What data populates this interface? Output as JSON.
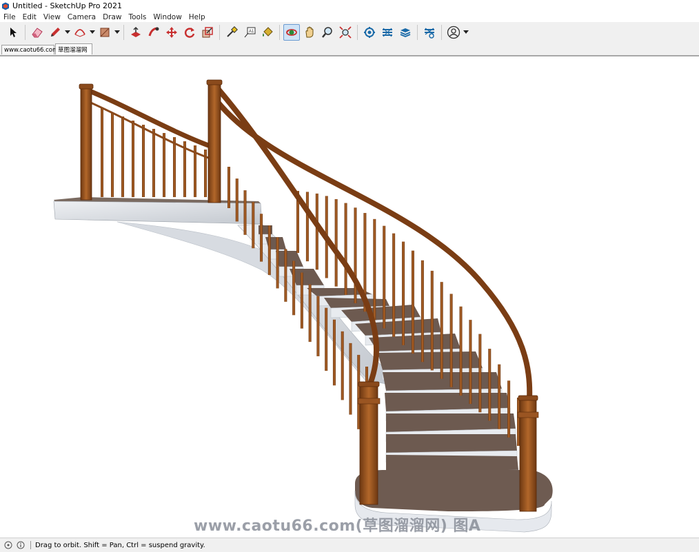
{
  "window": {
    "title": "Untitled - SketchUp Pro 2021"
  },
  "menu": [
    "File",
    "Edit",
    "View",
    "Camera",
    "Draw",
    "Tools",
    "Window",
    "Help"
  ],
  "toolbar": {
    "tools": [
      {
        "name": "select-icon"
      },
      {
        "name": "eraser-icon"
      },
      {
        "name": "pencil-icon"
      },
      {
        "name": "arc-icon"
      },
      {
        "name": "rectangle-icon"
      },
      {
        "name": "push-pull-icon"
      },
      {
        "name": "follow-me-icon"
      },
      {
        "name": "move-icon"
      },
      {
        "name": "rotate-icon"
      },
      {
        "name": "scale-icon"
      },
      {
        "name": "tape-measure-icon"
      },
      {
        "name": "text-icon"
      },
      {
        "name": "paint-bucket-icon"
      },
      {
        "name": "orbit-icon"
      },
      {
        "name": "pan-icon"
      },
      {
        "name": "zoom-icon"
      },
      {
        "name": "zoom-extents-icon"
      },
      {
        "name": "warehouse-icon"
      },
      {
        "name": "extension-warehouse-icon"
      },
      {
        "name": "layout-icon"
      },
      {
        "name": "extension-manager-icon"
      },
      {
        "name": "account-icon"
      }
    ]
  },
  "tabs": [
    {
      "label": "www.caotu66.com"
    },
    {
      "label": "草图溜溜网"
    }
  ],
  "viewport": {
    "watermark": "www.caotu66.com(草图溜溜网) 图A"
  },
  "status": {
    "message": "Drag to orbit. Shift = Pan, Ctrl = suspend gravity."
  },
  "colors": {
    "wood": "#8a4a1c",
    "wood_light": "#b0682c",
    "tread": "#6d5a50",
    "riser": "#e8ebef",
    "stringer": "#d4d8de",
    "active_tool": "#cfe3f7"
  }
}
